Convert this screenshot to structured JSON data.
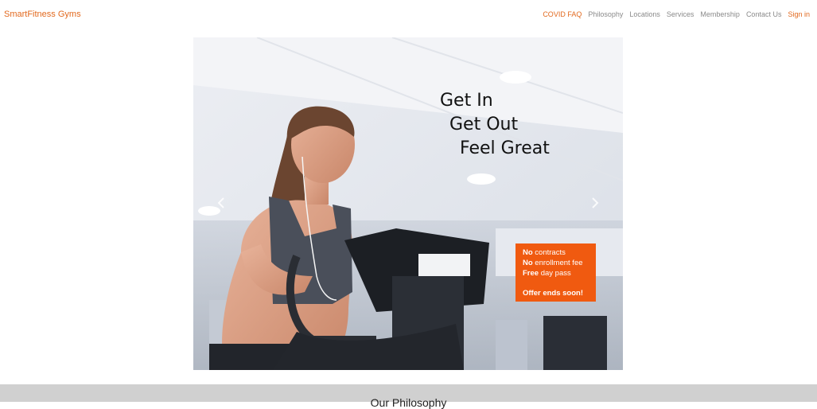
{
  "brand": "SmartFitness Gyms",
  "nav": {
    "items": [
      {
        "label": "COVID FAQ",
        "accent": true
      },
      {
        "label": "Philosophy",
        "accent": false
      },
      {
        "label": "Locations",
        "accent": false
      },
      {
        "label": "Services",
        "accent": false
      },
      {
        "label": "Membership",
        "accent": false
      },
      {
        "label": "Contact Us",
        "accent": false
      },
      {
        "label": "Sign in",
        "accent": true
      }
    ]
  },
  "hero": {
    "tagline": [
      "Get In",
      "Get Out",
      "Feel Great"
    ],
    "offer": {
      "line1_bold": "No",
      "line1_rest": " contracts",
      "line2_bold": "No",
      "line2_rest": " enrollment fee",
      "line3_bold": "Free",
      "line3_rest": " day pass",
      "ends": "Offer ends soon!"
    },
    "controls": {
      "prev_icon": "chevron-left-icon",
      "next_icon": "chevron-right-icon"
    }
  },
  "section": {
    "title": "Our Philosophy"
  },
  "colors": {
    "accent": "#e2691e",
    "offer_bg": "#f05a10",
    "band_bg": "#d0d0d0"
  }
}
